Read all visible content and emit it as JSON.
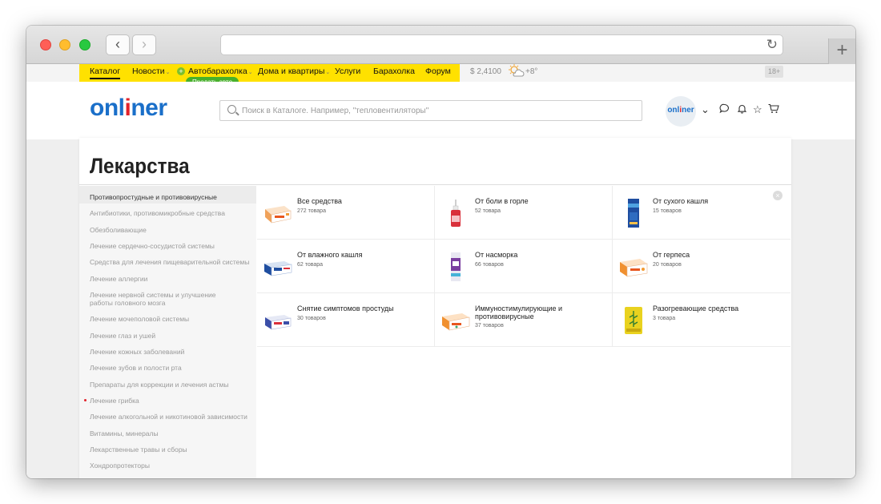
{
  "browser": {
    "back_icon": "chevron-left-icon",
    "forward_icon": "chevron-right-icon",
    "reload_icon": "reload-icon",
    "new_tab_icon": "plus-icon",
    "back_glyph": "‹",
    "forward_glyph": "›",
    "reload_glyph": "↻",
    "new_tab_glyph": "+"
  },
  "topnav": {
    "items": [
      {
        "label": "Каталог",
        "active": true
      },
      {
        "label": "Новости",
        "dropdown": true
      },
      {
        "label": "Автобарахолка",
        "dropdown": true
      },
      {
        "label": "Дома и квартиры",
        "dropdown": true
      },
      {
        "label": "Услуги"
      },
      {
        "label": "Барахолка"
      },
      {
        "label": "Форум"
      }
    ],
    "sell_badge": "Продать авто",
    "rate": "$ 2,4100",
    "temperature": "+8°",
    "age": "18+",
    "dropdown_glyph": "⌄",
    "plus_glyph": "+"
  },
  "header": {
    "logo_part1": "onl",
    "logo_accent": "i",
    "logo_part2": "ner",
    "search_placeholder": "Поиск в Каталоге. Например, \"тепловентиляторы\"",
    "avatar_text_part1": "onl",
    "avatar_text_accent": "i",
    "avatar_text_part2": "ner",
    "chevron_glyph": "⌄",
    "chat_glyph": "◯",
    "bell_glyph": "♫",
    "star_glyph": "☆",
    "cart_glyph": "⊔"
  },
  "page": {
    "title": "Лекарства",
    "close_glyph": "×"
  },
  "sidebar": {
    "items": [
      {
        "label": "Противопростудные и противовирусные",
        "active": true
      },
      {
        "label": "Антибиотики, противомикробные средства"
      },
      {
        "label": "Обезболивающие"
      },
      {
        "label": "Лечение сердечно-сосудистой системы"
      },
      {
        "label": "Средства для лечения пищеварительной системы"
      },
      {
        "label": "Лечение аллергии"
      },
      {
        "label": "Лечение нервной системы и улучшение работы головного мозга"
      },
      {
        "label": "Лечение мочеполовой системы"
      },
      {
        "label": "Лечение глаз и ушей"
      },
      {
        "label": "Лечение кожных заболеваний"
      },
      {
        "label": "Лечение зубов и полости рта"
      },
      {
        "label": "Препараты для коррекции и лечения астмы"
      },
      {
        "label": "Лечение грибка",
        "marked": true
      },
      {
        "label": "Лечение алкогольной и никотиновой зависимости"
      },
      {
        "label": "Витамины, минералы"
      },
      {
        "label": "Лекарственные травы и сборы"
      },
      {
        "label": "Хондропротекторы"
      }
    ]
  },
  "categories": [
    {
      "title": "Все средства",
      "count": "272 товара",
      "image": "pill-box-icon"
    },
    {
      "title": "От боли в горле",
      "count": "52 товара",
      "image": "spray-bottle-icon"
    },
    {
      "title": "От сухого кашля",
      "count": "15 товаров",
      "image": "syrup-box-icon"
    },
    {
      "title": "От влажного кашля",
      "count": "62 товара",
      "image": "tablet-box-icon"
    },
    {
      "title": "От насморка",
      "count": "66 товаров",
      "image": "nasal-spray-icon"
    },
    {
      "title": "От герпеса",
      "count": "20 товаров",
      "image": "cream-box-icon"
    },
    {
      "title": "Снятие симптомов простуды",
      "count": "30 товаров",
      "image": "powder-box-icon"
    },
    {
      "title": "Иммуностимулирующие и противовирусные",
      "count": "37 товаров",
      "image": "capsule-box-icon"
    },
    {
      "title": "Разогревающие средства",
      "count": "3 товара",
      "image": "herbal-pack-icon"
    }
  ]
}
